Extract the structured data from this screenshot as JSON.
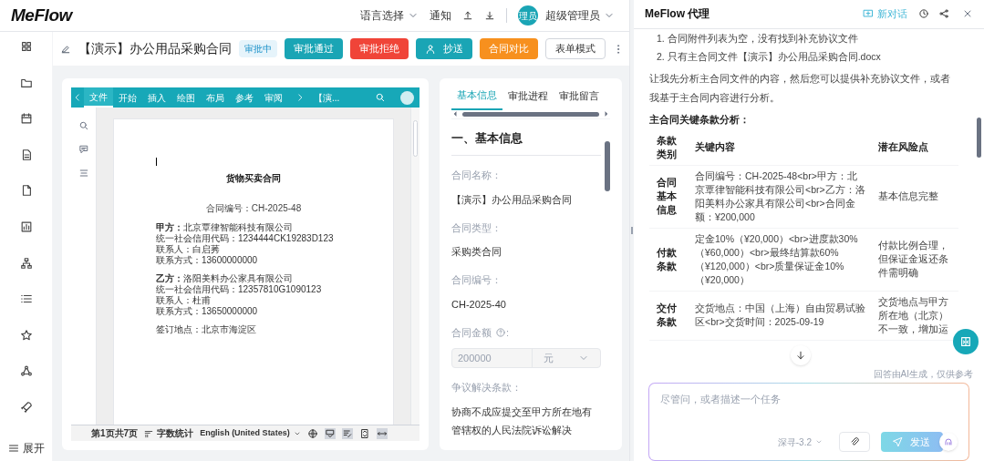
{
  "header": {
    "logo": "MeFlow",
    "language": "语言选择",
    "notifications": "通知",
    "avatar": "理员",
    "user": "超级管理员"
  },
  "sidebar": {
    "expand_label": "展开"
  },
  "contract": {
    "title": "【演示】办公用品采购合同",
    "status": "审批中",
    "actions": [
      {
        "label": "审批通过",
        "kind": "approve"
      },
      {
        "label": "审批拒绝",
        "kind": "reject"
      },
      {
        "label": "抄送",
        "kind": "cc"
      },
      {
        "label": "合同对比",
        "kind": "compare"
      },
      {
        "label": "表单模式",
        "kind": "plain"
      }
    ]
  },
  "document": {
    "ribbon_tabs": [
      {
        "label": "文件",
        "selected": true
      },
      {
        "label": "开始",
        "selected": false
      },
      {
        "label": "插入",
        "selected": false
      },
      {
        "label": "绘图",
        "selected": false
      },
      {
        "label": "布局",
        "selected": false
      },
      {
        "label": "参考",
        "selected": false
      },
      {
        "label": "审阅",
        "selected": false
      }
    ],
    "file_tab": "【演...",
    "page": {
      "title": "货物买卖合同",
      "number": "合同编号：CH-2025-48",
      "blocks": [
        [
          "**甲方：**北京覃律智能科技有限公司",
          "统一社会信用代码：1234444CK19283D123",
          "联系人：白启莠",
          "联系方式：13600000000"
        ],
        [
          "**乙方：**洛阳美料办公家具有限公司",
          "统一社会信用代码：12357810G1090123",
          "联系人：杜甫",
          "联系方式：13650000000"
        ],
        [
          "签订地点：北京市海淀区"
        ]
      ]
    },
    "status_bar": {
      "page": "第1页共7页",
      "word_count": "字数统计",
      "language": "English (United States)"
    }
  },
  "info_panel": {
    "tabs": [
      {
        "label": "基本信息",
        "selected": true
      },
      {
        "label": "审批进程",
        "selected": false
      },
      {
        "label": "审批留言",
        "selected": false
      }
    ],
    "section": "一、基本信息",
    "fields": [
      {
        "kind": "text",
        "label": "合同名称：",
        "value": "【演示】办公用品采购合同"
      },
      {
        "kind": "text",
        "label": "合同类型：",
        "value": "采购类合同"
      },
      {
        "kind": "text",
        "label": "合同编号：",
        "value": "CH-2025-40"
      },
      {
        "kind": "amount",
        "label": "合同金额",
        "suffix": ":",
        "value": "200000",
        "unit": "元",
        "disabled": true
      },
      {
        "kind": "text",
        "label": "争议解决条款：",
        "value": "协商不成应提交至甲方所在地有管辖权的人民法院诉讼解决"
      }
    ]
  },
  "assistant": {
    "title": "MeFlow 代理",
    "new_chat": "新对话",
    "list": [
      "1. 合同附件列表为空，没有找到补充协议文件",
      "2. 只有主合同文件【演示】办公用品采购合同.docx"
    ],
    "paragraph": "让我先分析主合同文件的内容，然后您可以提供补充协议文件，或者我基于主合同内容进行分析。",
    "heading": "主合同关键条款分析：",
    "table": {
      "columns": [
        "条款类别",
        "关键内容",
        "潜在风险点"
      ],
      "rows": [
        [
          "合同基本信息",
          "合同编号：CH-2025-48<br>甲方：北京覃律智能科技有限公司<br>乙方：洛阳美料办公家具有限公司<br>合同金额：¥200,000",
          "基本信息完整"
        ],
        [
          "付款条款",
          "定金10%（¥20,000）<br>进度款30%（¥60,000）<br>最终结算款60%（¥120,000）<br>质量保证金10%（¥20,000）",
          "付款比例合理，但保证金返还条件需明确"
        ],
        [
          "交付条款",
          "交货地点：中国（上海）自由贸易试验区<br>交货时间：2025-09-19",
          "交货地点与甲方所在地（北京）不一致，增加运"
        ]
      ]
    },
    "disclaimer": "回答由AI生成，仅供参考",
    "input": {
      "placeholder": "尽管问，或者描述一个任务"
    },
    "model": "深寻-3.2",
    "send": "发送"
  }
}
